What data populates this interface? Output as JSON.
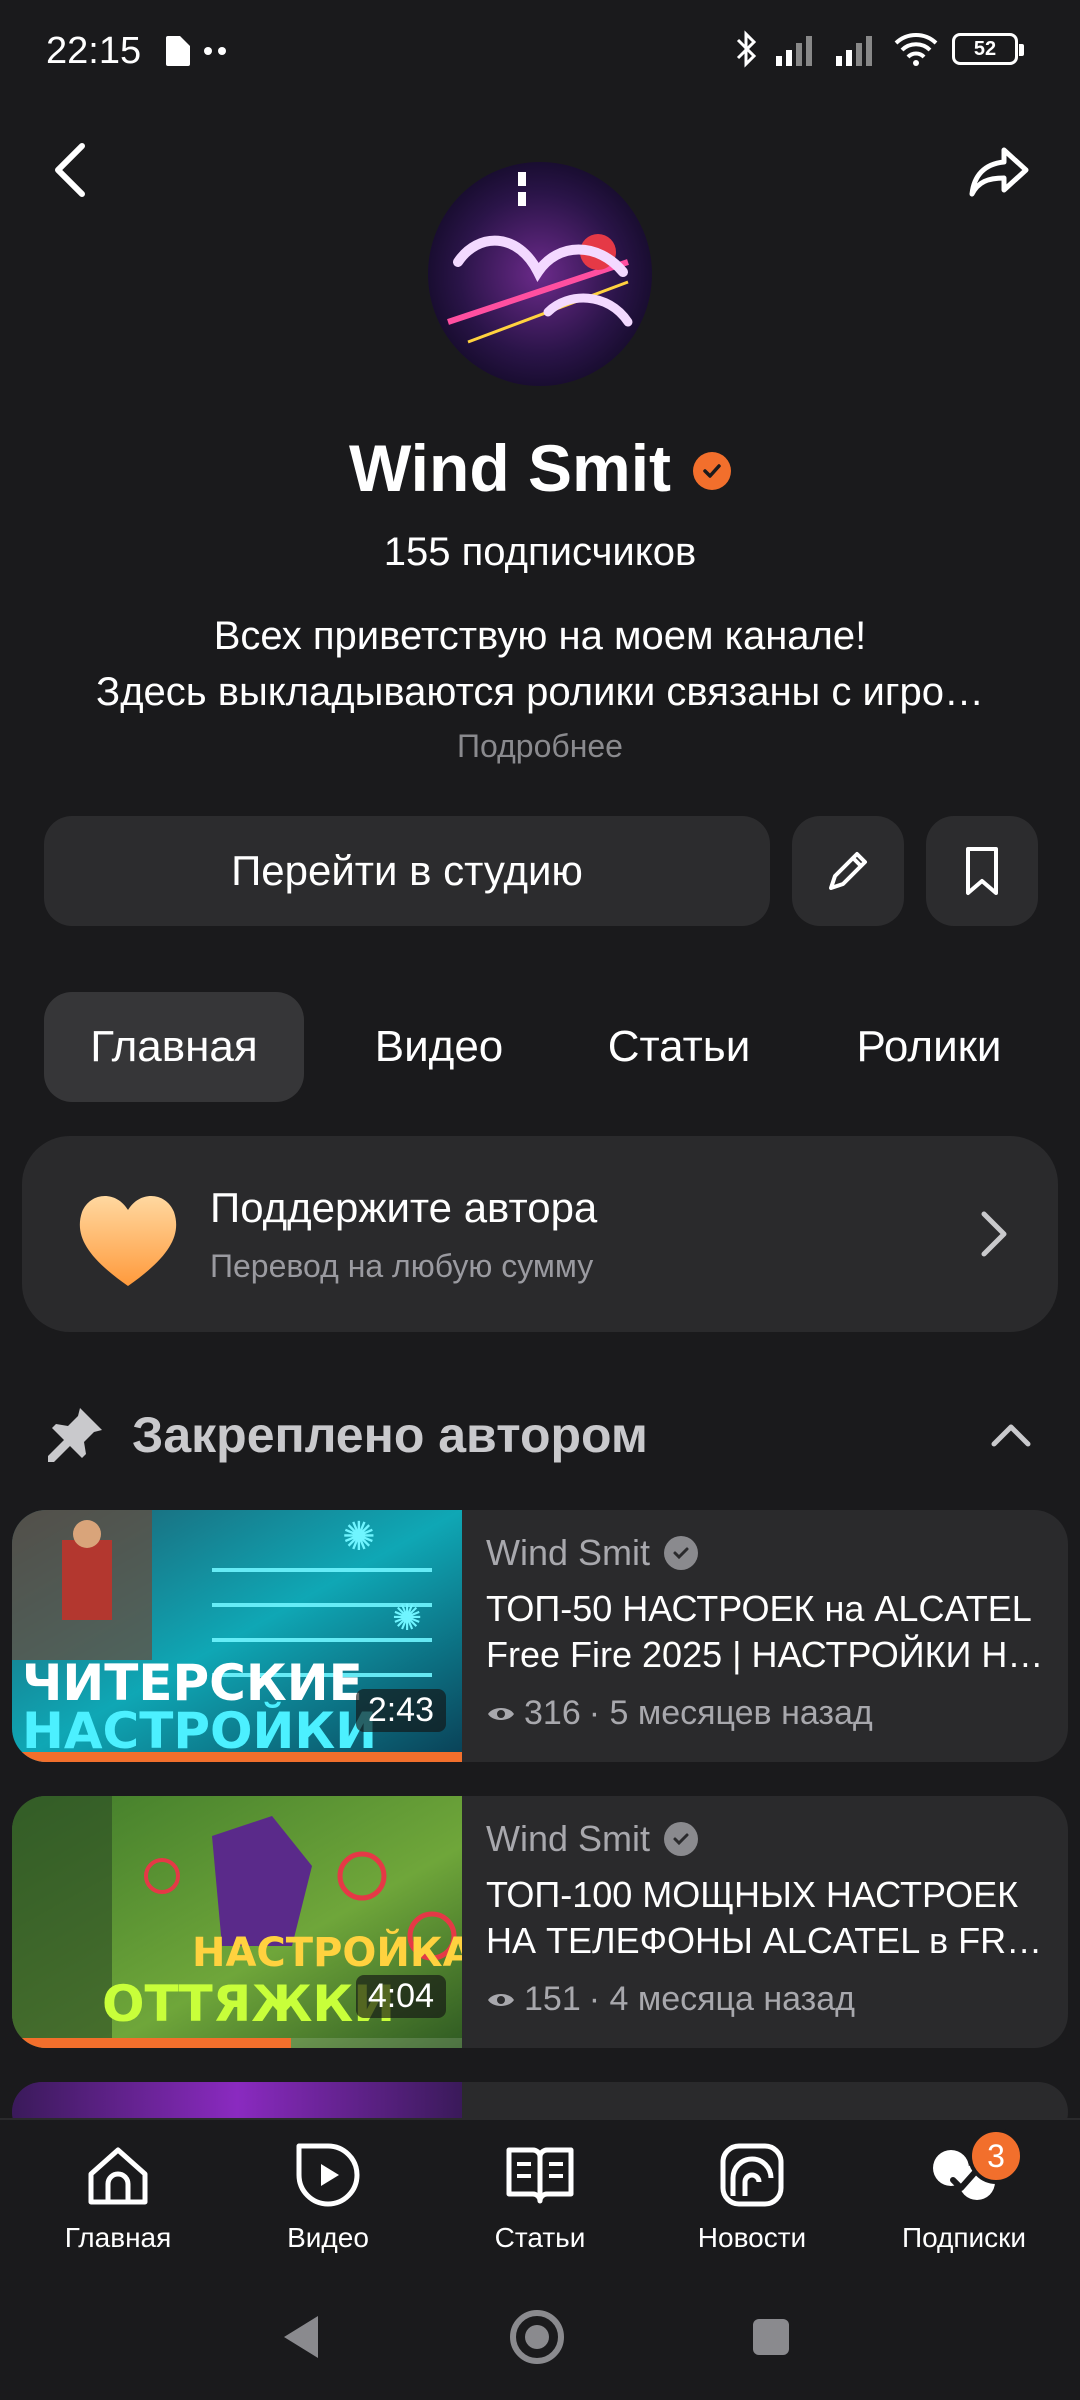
{
  "status_bar": {
    "time": "22:15",
    "battery": "52"
  },
  "channel": {
    "name": "Wind Smit",
    "subscribers": "155 подписчиков",
    "description_line1": "Всех приветствую на моем канале!",
    "description_line2": "Здесь выкладываются ролики связаны с игро…",
    "more_label": "Подробнее",
    "verified_color": "#f26f2c"
  },
  "actions": {
    "studio_label": "Перейти в студию"
  },
  "tabs": [
    {
      "label": "Главная",
      "active": true
    },
    {
      "label": "Видео",
      "active": false
    },
    {
      "label": "Статьи",
      "active": false
    },
    {
      "label": "Ролики",
      "active": false
    }
  ],
  "support": {
    "title": "Поддержите автора",
    "subtitle": "Перевод на любую сумму"
  },
  "pinned": {
    "title": "Закреплено автором"
  },
  "videos": [
    {
      "author": "Wind Smit",
      "title_line1": "ТОП-50 НАСТРОЕК на ALCATEL",
      "title_line2": "Free Fire 2025 | НАСТРОЙКИ Н…",
      "views": "316",
      "age": "· 5 месяцев назад",
      "duration": "2:43",
      "thumb_text1": "ЧИТЕРСКИЕ",
      "thumb_text2": "НАСТРОЙКИ",
      "progress": 1.0
    },
    {
      "author": "Wind Smit",
      "title_line1": "ТОП-100 МОЩНЫХ НАСТРОЕК",
      "title_line2": "НА ТЕЛЕФОНЫ ALCATEL в FRE…",
      "views": "151",
      "age": "· 4 месяца назад",
      "duration": "4:04",
      "thumb_text1": "НАСТРОЙКА",
      "thumb_text2": "ОТТЯЖКИ",
      "progress": 0.62
    }
  ],
  "bottom_nav": [
    {
      "label": "Главная",
      "icon": "home-icon"
    },
    {
      "label": "Видео",
      "icon": "video-icon"
    },
    {
      "label": "Статьи",
      "icon": "articles-icon"
    },
    {
      "label": "Новости",
      "icon": "news-icon"
    },
    {
      "label": "Подписки",
      "icon": "subscriptions-icon",
      "badge": "3"
    }
  ],
  "accent_color": "#f26f2c"
}
